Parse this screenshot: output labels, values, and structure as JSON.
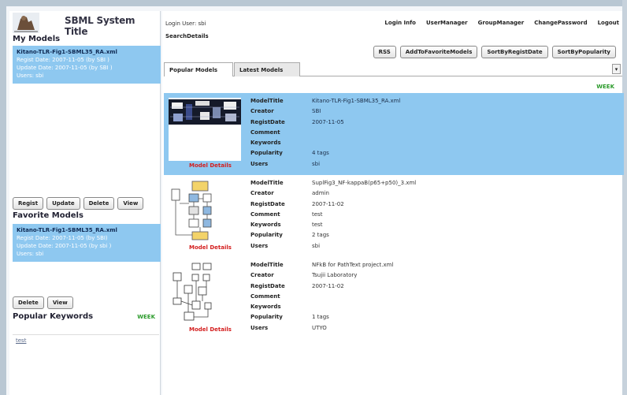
{
  "app": {
    "title": "SBML System Title"
  },
  "left": {
    "my_models_title": "My Models",
    "my_models": [
      {
        "name": "Kitano-TLR-Fig1-SBML35_RA.xml",
        "regist": "Regist Date: 2007-11-05 (by SBI )",
        "update": "Update Date: 2007-11-05 (by SBI )",
        "users": "Users: sbi"
      }
    ],
    "my_models_buttons": [
      "Regist",
      "Update",
      "Delete",
      "View"
    ],
    "favorite_title": "Favorite Models",
    "favorites": [
      {
        "name": "Kitano-TLR-Fig1-SBML35_RA.xml",
        "regist": "Regist Date: 2007-11-05 (by SBI)",
        "update": "Update Date: 2007-11-05 (by sbi )",
        "users": "Users: sbi"
      }
    ],
    "favorite_buttons": [
      "Delete",
      "View"
    ],
    "keywords_title": "Popular Keywords",
    "keywords_period": "WEEK",
    "keywords": [
      "test"
    ]
  },
  "header": {
    "login_user": "Login User: sbi",
    "links": [
      "Login Info",
      "UserManager",
      "GroupManager",
      "ChangePassword",
      "Logout"
    ],
    "search_details": "SearchDetails",
    "actions": [
      "RSS",
      "AddToFavoriteModels",
      "SortByRegistDate",
      "SortByPopularity"
    ]
  },
  "tabs": [
    "Popular Models",
    "Latest Models"
  ],
  "tab_menu_icon": "▾",
  "period": "WEEK",
  "field_labels": [
    "ModelTitle",
    "Creator",
    "RegistDate",
    "Comment",
    "Keywords",
    "Popularity",
    "Users"
  ],
  "details_label": "Model Details",
  "results": [
    {
      "title": "Kitano-TLR-Fig1-SBML35_RA.xml",
      "creator": "SBI",
      "date": "2007-11-05",
      "comment": "",
      "keywords": "",
      "popularity": "4 tags",
      "users": "sbi"
    },
    {
      "title": "SuplFig3_NF-kappaB(p65+p50)_3.xml",
      "creator": "admin",
      "date": "2007-11-02",
      "comment": "test",
      "keywords": "test",
      "popularity": "2 tags",
      "users": "sbi"
    },
    {
      "title": "NFkB for PathText project.xml",
      "creator": "Tsujii Laboratory",
      "date": "2007-11-02",
      "comment": "",
      "keywords": "",
      "popularity": "1 tags",
      "users": "UTYO"
    }
  ],
  "colors": {
    "selection": "#8ec8f0",
    "week": "#2a9a2a",
    "details_link": "#d42020"
  }
}
